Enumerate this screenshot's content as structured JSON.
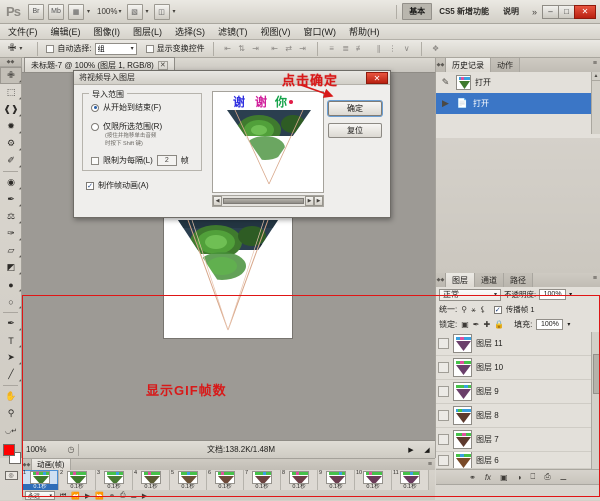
{
  "appbar": {
    "logo": "Ps",
    "zoom": "100%",
    "workspace_button": "基本",
    "links": [
      "CS5 新增功能",
      "说明"
    ],
    "more": "»",
    "window_buttons": [
      "–",
      "□",
      "✕"
    ],
    "icons": [
      "bridge-icon",
      "mini-bridge-icon",
      "view-extras-icon",
      "zoom-level",
      "arrange-documents-icon",
      "screen-mode-icon"
    ]
  },
  "menubar": {
    "items": [
      "文件(F)",
      "编辑(E)",
      "图像(I)",
      "图层(L)",
      "选择(S)",
      "滤镜(T)",
      "视图(V)",
      "窗口(W)",
      "帮助(H)"
    ]
  },
  "optionsbar": {
    "tool_icon": "move-tool-icon",
    "auto_select_label": "自动选择:",
    "auto_select_value": "组",
    "show_transform_label": "显示变换控件",
    "align_icons": [
      "align-top-icon",
      "align-vcenter-icon",
      "align-bottom-icon",
      "align-left-icon",
      "align-hcenter-icon",
      "align-right-icon"
    ],
    "distribute_icons": [
      "dist-top-icon",
      "dist-vcenter-icon",
      "dist-bottom-icon",
      "dist-left-icon",
      "dist-hcenter-icon",
      "dist-right-icon"
    ],
    "auto_align_icon": "auto-align-icon"
  },
  "toolbox": {
    "tools": [
      {
        "name": "move-tool",
        "glyph": "✙",
        "selected": true
      },
      {
        "name": "marquee-tool",
        "glyph": "⬚",
        "selected": false
      },
      {
        "name": "lasso-tool",
        "glyph": "✠",
        "selected": false
      },
      {
        "name": "quick-selection-tool",
        "glyph": "❁",
        "selected": false
      },
      {
        "name": "crop-tool",
        "glyph": "⌗",
        "selected": false
      },
      {
        "name": "eyedropper-tool",
        "glyph": "✐",
        "selected": false
      },
      {
        "name": "healing-brush-tool",
        "glyph": "◕",
        "selected": false
      },
      {
        "name": "brush-tool",
        "glyph": "✒",
        "selected": false
      },
      {
        "name": "clone-stamp-tool",
        "glyph": "⚑",
        "selected": false
      },
      {
        "name": "history-brush-tool",
        "glyph": "✁",
        "selected": false
      },
      {
        "name": "eraser-tool",
        "glyph": "▱",
        "selected": false
      },
      {
        "name": "gradient-tool",
        "glyph": "◩",
        "selected": false
      },
      {
        "name": "blur-tool",
        "glyph": "●",
        "selected": false
      },
      {
        "name": "dodge-tool",
        "glyph": "○",
        "selected": false
      },
      {
        "name": "pen-tool",
        "glyph": "✒",
        "selected": false
      },
      {
        "name": "type-tool",
        "glyph": "T",
        "selected": false
      },
      {
        "name": "path-selection-tool",
        "glyph": "➤",
        "selected": false
      },
      {
        "name": "line-tool",
        "glyph": "╱",
        "selected": false
      },
      {
        "name": "hand-tool",
        "glyph": "✋",
        "selected": false
      },
      {
        "name": "zoom-tool",
        "glyph": "⌕",
        "selected": false
      }
    ],
    "foreground_color": "#ff0000",
    "background_color": "#ffffff",
    "quick_mask_icon": "quick-mask-icon"
  },
  "document": {
    "tab_title": "未标题-7 @ 100% (图层 1, RGB/8)",
    "close_glyph": "✕",
    "status_zoom": "100%",
    "status_doc": "文档:138.2K/1.48M"
  },
  "dialog": {
    "title": "将视频导入图层",
    "close_glyph": "✕",
    "fieldset_legend": "导入范围",
    "radio_from_start": "从开始到结束(F)",
    "radio_selected_range": "仅限所选范围(R)",
    "hint_line1": "(按住并拖移单击音频",
    "hint_line2": "时按下 Shift 键)",
    "limit_label": "限制为每隔(L)",
    "limit_value": "2",
    "limit_unit": "帧",
    "make_animation": "制作帧动画(A)",
    "ok_button": "确定",
    "reset_button": "复位"
  },
  "history_panel": {
    "tabs": [
      "历史记录",
      "动作"
    ],
    "menu_glyph": "≡",
    "entries": [
      {
        "label": "打开",
        "icon": "snapshot-icon",
        "selected": false
      },
      {
        "label": "打开",
        "icon": "document-icon",
        "selected": true
      }
    ]
  },
  "layers_panel": {
    "tabs": [
      "图层",
      "通道",
      "路径"
    ],
    "menu_glyph": "≡",
    "blend_mode": "正常",
    "opacity_label": "不透明度:",
    "opacity_value": "100%",
    "unify_label": "统一:",
    "propagate_label": "传播帧 1",
    "lock_label": "锁定:",
    "fill_label": "填充:",
    "fill_value": "100%",
    "layers": [
      {
        "name": "图层 11"
      },
      {
        "name": "图层 10"
      },
      {
        "name": "图层 9"
      },
      {
        "name": "图层 8"
      },
      {
        "name": "图层 7"
      },
      {
        "name": "图层 6"
      }
    ],
    "footer_icons": [
      "link-layers-icon",
      "layer-style-icon",
      "layer-mask-icon",
      "adjustment-layer-icon",
      "new-group-icon",
      "new-layer-icon",
      "delete-layer-icon"
    ]
  },
  "animation_panel": {
    "tab": "动画(帧)",
    "menu_glyph": "≡",
    "frames": [
      {
        "number": "1",
        "delay": "0.1秒",
        "selected": true
      },
      {
        "number": "2",
        "delay": "0.1秒",
        "selected": false
      },
      {
        "number": "3",
        "delay": "0.1秒",
        "selected": false
      },
      {
        "number": "4",
        "delay": "0.1秒",
        "selected": false
      },
      {
        "number": "5",
        "delay": "0.1秒",
        "selected": false
      },
      {
        "number": "6",
        "delay": "0.1秒",
        "selected": false
      },
      {
        "number": "7",
        "delay": "0.1秒",
        "selected": false
      },
      {
        "number": "8",
        "delay": "0.1秒",
        "selected": false
      },
      {
        "number": "9",
        "delay": "0.1秒",
        "selected": false
      },
      {
        "number": "10",
        "delay": "0.1秒",
        "selected": false
      },
      {
        "number": "11",
        "delay": "0.1秒",
        "selected": false
      }
    ],
    "loop_value": "永远",
    "controls": [
      "select-first-frame-icon",
      "select-previous-frame-icon",
      "play-icon",
      "select-next-frame-icon",
      "tween-icon",
      "duplicate-frame-icon",
      "delete-frame-icon"
    ]
  },
  "annotations": {
    "click_ok": "点击确定",
    "show_gif_frames": "显示GIF帧数",
    "color": "#d81919"
  }
}
